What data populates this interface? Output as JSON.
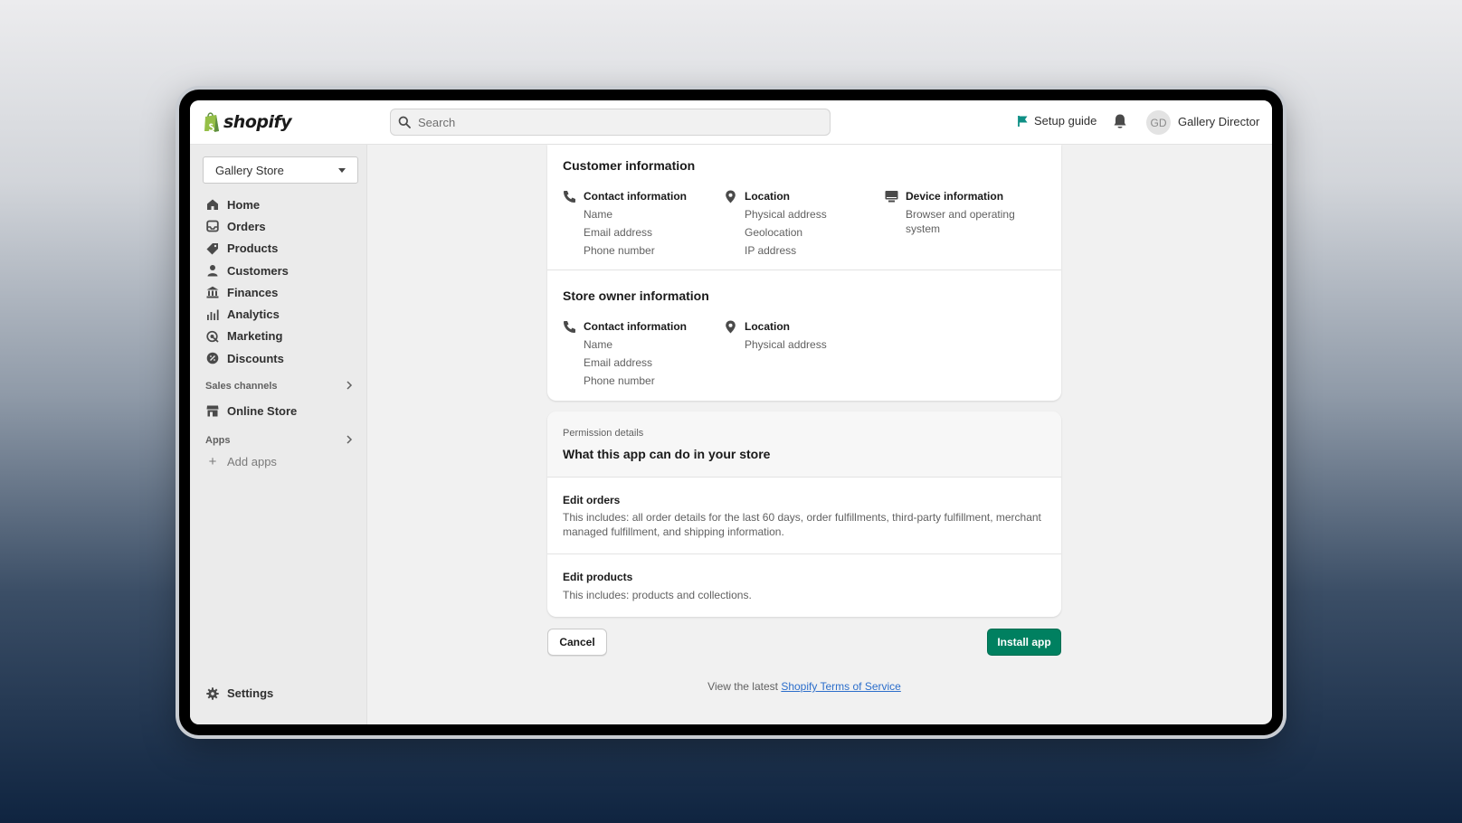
{
  "brand": {
    "name": "shopify"
  },
  "colors": {
    "primary": "#008060",
    "link": "#2c6ecb",
    "setup_flag": "#0e8f85"
  },
  "topbar": {
    "search_placeholder": "Search",
    "setup_guide": "Setup guide",
    "user_initials": "GD",
    "user_name": "Gallery Director"
  },
  "sidebar": {
    "store_name": "Gallery Store",
    "items": [
      {
        "label": "Home",
        "icon": "home-icon"
      },
      {
        "label": "Orders",
        "icon": "inbox-icon"
      },
      {
        "label": "Products",
        "icon": "tag-icon"
      },
      {
        "label": "Customers",
        "icon": "person-icon"
      },
      {
        "label": "Finances",
        "icon": "bank-icon"
      },
      {
        "label": "Analytics",
        "icon": "bar-chart-icon"
      },
      {
        "label": "Marketing",
        "icon": "target-icon"
      },
      {
        "label": "Discounts",
        "icon": "discount-icon"
      }
    ],
    "sales_channels_label": "Sales channels",
    "online_store": "Online Store",
    "apps_label": "Apps",
    "add_apps": "Add apps",
    "settings": "Settings"
  },
  "customer_info": {
    "title": "Customer information",
    "contact": {
      "head": "Contact information",
      "lines": [
        "Name",
        "Email address",
        "Phone number"
      ]
    },
    "location": {
      "head": "Location",
      "lines": [
        "Physical address",
        "Geolocation",
        "IP address"
      ]
    },
    "device": {
      "head": "Device information",
      "lines": [
        "Browser and operating",
        "system"
      ]
    }
  },
  "owner_info": {
    "title": "Store owner information",
    "contact": {
      "head": "Contact information",
      "lines": [
        "Name",
        "Email address",
        "Phone number"
      ]
    },
    "location": {
      "head": "Location",
      "lines": [
        "Physical address"
      ]
    }
  },
  "permissions": {
    "kicker": "Permission details",
    "title": "What this app can do in your store",
    "items": [
      {
        "title": "Edit orders",
        "desc": "This includes: all order details for the last 60 days, order fulfillments, third-party fulfillment, merchant managed fulfillment, and shipping information."
      },
      {
        "title": "Edit products",
        "desc": "This includes: products and collections."
      }
    ]
  },
  "actions": {
    "cancel": "Cancel",
    "install": "Install app"
  },
  "footer": {
    "prefix": "View the latest ",
    "link": "Shopify Terms of Service"
  }
}
